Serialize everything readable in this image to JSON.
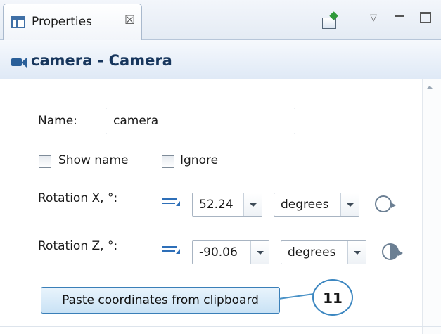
{
  "tab": {
    "label": "Properties",
    "close_glyph": "☒"
  },
  "view_toolbar": {
    "icons": [
      "new-view-icon",
      "view-menu-icon",
      "minimize-icon",
      "maximize-icon"
    ]
  },
  "title": {
    "text": "camera - Camera",
    "icon": "camera-icon"
  },
  "form": {
    "name_label": "Name:",
    "name_value": "camera",
    "show_name_label": "Show name",
    "show_name_checked": false,
    "ignore_label": "Ignore",
    "ignore_checked": false,
    "rotation_x": {
      "label": "Rotation X, °:",
      "value": "52.24",
      "unit": "degrees"
    },
    "rotation_z": {
      "label": "Rotation Z, °:",
      "value": "-90.06",
      "unit": "degrees"
    },
    "paste_button": "Paste coordinates from clipboard"
  },
  "callout": {
    "number": "11"
  },
  "colors": {
    "accent": "#2e6fb8",
    "title_text": "#17365d",
    "button_border": "#3a7fb8",
    "callout_border": "#3b86c0"
  }
}
